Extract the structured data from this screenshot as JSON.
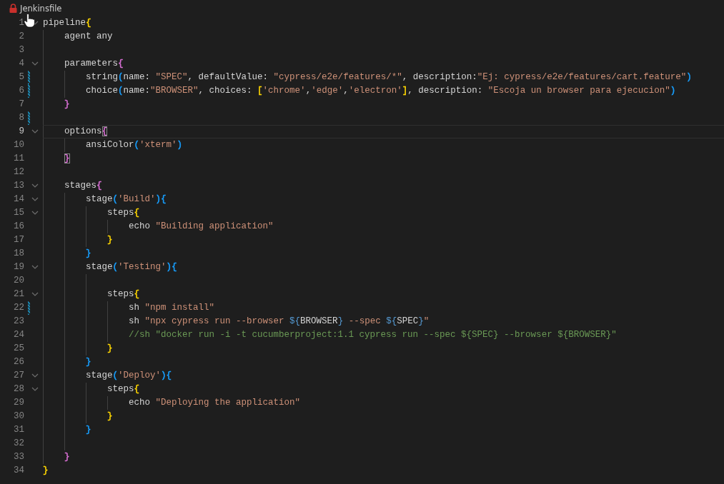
{
  "title": "Jenkinsfile",
  "lines": [
    {
      "number": "1",
      "fold": true,
      "modified": false,
      "current": false,
      "tokens": [
        {
          "kind": "text",
          "text": "pipeline"
        },
        {
          "kind": "bracket",
          "text": "{",
          "color": "#ffd700",
          "matched": false
        }
      ]
    },
    {
      "number": "2",
      "fold": false,
      "modified": false,
      "current": false,
      "tokens": [
        {
          "kind": "text",
          "text": "    agent any"
        }
      ]
    },
    {
      "number": "3",
      "fold": false,
      "modified": false,
      "current": false
    },
    {
      "number": "4",
      "fold": true,
      "modified": false,
      "current": false,
      "tokens": [
        {
          "kind": "text",
          "text": "    parameters"
        },
        {
          "kind": "bracket",
          "text": "{",
          "color": "#da70d6",
          "matched": false
        }
      ]
    },
    {
      "number": "5",
      "fold": false,
      "modified": true,
      "current": false,
      "tokens": [
        {
          "kind": "text",
          "text": "        string"
        },
        {
          "kind": "bracket",
          "text": "(",
          "color": "#179fff",
          "matched": false
        },
        {
          "kind": "text",
          "text": "name: "
        },
        {
          "kind": "string",
          "text": "\"SPEC\""
        },
        {
          "kind": "text",
          "text": ", defaultValue: "
        },
        {
          "kind": "string",
          "text": "\"cypress/e2e/features/*\""
        },
        {
          "kind": "text",
          "text": ", description:"
        },
        {
          "kind": "string",
          "text": "\"Ej: cypress/e2e/features/cart.feature\""
        },
        {
          "kind": "bracket",
          "text": ")",
          "color": "#179fff",
          "matched": false
        }
      ]
    },
    {
      "number": "6",
      "fold": false,
      "modified": true,
      "current": false,
      "tokens": [
        {
          "kind": "text",
          "text": "        choice"
        },
        {
          "kind": "bracket",
          "text": "(",
          "color": "#179fff",
          "matched": false
        },
        {
          "kind": "text",
          "text": "name:"
        },
        {
          "kind": "string",
          "text": "\"BROWSER\""
        },
        {
          "kind": "text",
          "text": ", choices: "
        },
        {
          "kind": "bracket",
          "text": "[",
          "color": "#ffd700",
          "matched": false
        },
        {
          "kind": "string",
          "text": "'chrome'"
        },
        {
          "kind": "text",
          "text": ","
        },
        {
          "kind": "string",
          "text": "'edge'"
        },
        {
          "kind": "text",
          "text": ","
        },
        {
          "kind": "string",
          "text": "'electron'"
        },
        {
          "kind": "bracket",
          "text": "]",
          "color": "#ffd700",
          "matched": false
        },
        {
          "kind": "text",
          "text": ", description: "
        },
        {
          "kind": "string",
          "text": "\"Escoja un browser para ejecucion\""
        },
        {
          "kind": "bracket",
          "text": ")",
          "color": "#179fff",
          "matched": false
        }
      ]
    },
    {
      "number": "7",
      "fold": false,
      "modified": false,
      "current": false,
      "tokens": [
        {
          "kind": "bracket",
          "text": "    }",
          "color": "#da70d6",
          "matched": false
        }
      ]
    },
    {
      "number": "8",
      "fold": false,
      "modified": true,
      "current": false
    },
    {
      "number": "9",
      "fold": true,
      "modified": false,
      "current": true,
      "tokens": [
        {
          "kind": "text",
          "text": "    options"
        },
        {
          "kind": "bracket",
          "text": "{",
          "color": "#da70d6",
          "matched": true
        }
      ]
    },
    {
      "number": "10",
      "fold": false,
      "modified": false,
      "current": false,
      "tokens": [
        {
          "kind": "text",
          "text": "        ansiColor"
        },
        {
          "kind": "bracket",
          "text": "(",
          "color": "#179fff",
          "matched": false
        },
        {
          "kind": "string",
          "text": "'xterm'"
        },
        {
          "kind": "bracket",
          "text": ")",
          "color": "#179fff",
          "matched": false
        }
      ]
    },
    {
      "number": "11",
      "fold": false,
      "modified": false,
      "current": false,
      "tokens": [
        {
          "kind": "bracket",
          "text": "    }",
          "color": "#da70d6",
          "matched": true
        }
      ]
    },
    {
      "number": "12",
      "fold": false,
      "modified": false,
      "current": false
    },
    {
      "number": "13",
      "fold": true,
      "modified": false,
      "current": false,
      "tokens": [
        {
          "kind": "text",
          "text": "    stages"
        },
        {
          "kind": "bracket",
          "text": "{",
          "color": "#da70d6",
          "matched": false
        }
      ]
    },
    {
      "number": "14",
      "fold": true,
      "modified": false,
      "current": false,
      "tokens": [
        {
          "kind": "text",
          "text": "        stage"
        },
        {
          "kind": "bracket",
          "text": "(",
          "color": "#179fff",
          "matched": false
        },
        {
          "kind": "string",
          "text": "'Build'"
        },
        {
          "kind": "bracket",
          "text": "){",
          "color": "#179fff",
          "matched": false
        }
      ]
    },
    {
      "number": "15",
      "fold": true,
      "modified": false,
      "current": false,
      "tokens": [
        {
          "kind": "text",
          "text": "            steps"
        },
        {
          "kind": "bracket",
          "text": "{",
          "color": "#ffd700",
          "matched": false
        }
      ]
    },
    {
      "number": "16",
      "fold": false,
      "modified": false,
      "current": false,
      "tokens": [
        {
          "kind": "text",
          "text": "                echo "
        },
        {
          "kind": "string",
          "text": "\"Building application\""
        }
      ]
    },
    {
      "number": "17",
      "fold": false,
      "modified": false,
      "current": false,
      "tokens": [
        {
          "kind": "bracket",
          "text": "            }",
          "color": "#ffd700",
          "matched": false
        }
      ]
    },
    {
      "number": "18",
      "fold": false,
      "modified": false,
      "current": false,
      "tokens": [
        {
          "kind": "bracket",
          "text": "        }",
          "color": "#179fff",
          "matched": false
        }
      ]
    },
    {
      "number": "19",
      "fold": true,
      "modified": false,
      "current": false,
      "tokens": [
        {
          "kind": "text",
          "text": "        stage"
        },
        {
          "kind": "bracket",
          "text": "(",
          "color": "#179fff",
          "matched": false
        },
        {
          "kind": "string",
          "text": "'Testing'"
        },
        {
          "kind": "bracket",
          "text": "){",
          "color": "#179fff",
          "matched": false
        }
      ]
    },
    {
      "number": "20",
      "fold": false,
      "modified": false,
      "current": false
    },
    {
      "number": "21",
      "fold": true,
      "modified": false,
      "current": false,
      "tokens": [
        {
          "kind": "text",
          "text": "            steps"
        },
        {
          "kind": "bracket",
          "text": "{",
          "color": "#ffd700",
          "matched": false
        }
      ]
    },
    {
      "number": "22",
      "fold": false,
      "modified": true,
      "current": false,
      "tokens": [
        {
          "kind": "text",
          "text": "                sh "
        },
        {
          "kind": "string",
          "text": "\"npm install\""
        }
      ]
    },
    {
      "number": "23",
      "fold": false,
      "modified": false,
      "current": false,
      "tokens": [
        {
          "kind": "text",
          "text": "                sh "
        },
        {
          "kind": "string",
          "text": "\"npx cypress run --browser "
        },
        {
          "kind": "interp",
          "text": "${"
        },
        {
          "kind": "text",
          "text": "BROWSER"
        },
        {
          "kind": "interp",
          "text": "}"
        },
        {
          "kind": "string",
          "text": " --spec "
        },
        {
          "kind": "interp",
          "text": "${"
        },
        {
          "kind": "text",
          "text": "SPEC"
        },
        {
          "kind": "interp",
          "text": "}"
        },
        {
          "kind": "string",
          "text": "\""
        }
      ]
    },
    {
      "number": "24",
      "fold": false,
      "modified": false,
      "current": false,
      "tokens": [
        {
          "kind": "comment",
          "text": "                //sh \"docker run -i -t cucumberproject:1.1 cypress run --spec ${SPEC} --browser ${BROWSER}\""
        }
      ]
    },
    {
      "number": "25",
      "fold": false,
      "modified": false,
      "current": false,
      "tokens": [
        {
          "kind": "bracket",
          "text": "            }",
          "color": "#ffd700",
          "matched": false
        }
      ]
    },
    {
      "number": "26",
      "fold": false,
      "modified": false,
      "current": false,
      "tokens": [
        {
          "kind": "bracket",
          "text": "        }",
          "color": "#179fff",
          "matched": false
        }
      ]
    },
    {
      "number": "27",
      "fold": true,
      "modified": false,
      "current": false,
      "tokens": [
        {
          "kind": "text",
          "text": "        stage"
        },
        {
          "kind": "bracket",
          "text": "(",
          "color": "#179fff",
          "matched": false
        },
        {
          "kind": "string",
          "text": "'Deploy'"
        },
        {
          "kind": "bracket",
          "text": "){",
          "color": "#179fff",
          "matched": false
        }
      ]
    },
    {
      "number": "28",
      "fold": true,
      "modified": false,
      "current": false,
      "tokens": [
        {
          "kind": "text",
          "text": "            steps"
        },
        {
          "kind": "bracket",
          "text": "{",
          "color": "#ffd700",
          "matched": false
        }
      ]
    },
    {
      "number": "29",
      "fold": false,
      "modified": false,
      "current": false,
      "tokens": [
        {
          "kind": "text",
          "text": "                echo "
        },
        {
          "kind": "string",
          "text": "\"Deploying the application\""
        }
      ]
    },
    {
      "number": "30",
      "fold": false,
      "modified": false,
      "current": false,
      "tokens": [
        {
          "kind": "bracket",
          "text": "            }",
          "color": "#ffd700",
          "matched": false
        }
      ]
    },
    {
      "number": "31",
      "fold": false,
      "modified": false,
      "current": false,
      "tokens": [
        {
          "kind": "bracket",
          "text": "        }",
          "color": "#179fff",
          "matched": false
        }
      ]
    },
    {
      "number": "32",
      "fold": false,
      "modified": false,
      "current": false
    },
    {
      "number": "33",
      "fold": false,
      "modified": false,
      "current": false,
      "tokens": [
        {
          "kind": "bracket",
          "text": "    }",
          "color": "#da70d6",
          "matched": false
        }
      ]
    },
    {
      "number": "34",
      "fold": false,
      "modified": false,
      "current": false,
      "tokens": [
        {
          "kind": "bracket",
          "text": "}",
          "color": "#ffd700",
          "matched": false
        }
      ]
    }
  ]
}
